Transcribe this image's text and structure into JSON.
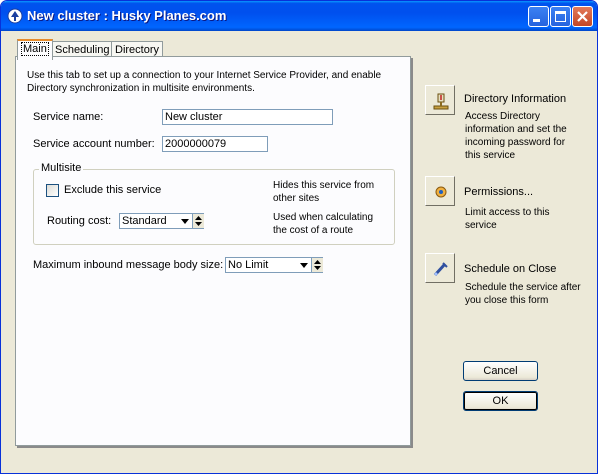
{
  "window": {
    "title": "New cluster : Husky Planes.com"
  },
  "tabs": [
    {
      "label": "Main",
      "active": true
    },
    {
      "label": "Scheduling",
      "active": false
    },
    {
      "label": "Directory",
      "active": false
    }
  ],
  "main": {
    "intro": "Use this tab to set up a connection to your Internet Service Provider, and enable Directory synchronization in multisite environments.",
    "service_name_label": "Service name:",
    "service_name_value": "New cluster",
    "account_label": "Service account number:",
    "account_value": "2000000079",
    "multisite": {
      "title": "Multisite",
      "exclude_label": "Exclude this service",
      "exclude_checked": false,
      "exclude_note": "Hides this service from other sites",
      "routing_label": "Routing cost:",
      "routing_value": "Standard",
      "routing_note": "Used when calculating the cost of a route"
    },
    "max_body_label": "Maximum inbound message body size:",
    "max_body_value": "No Limit"
  },
  "side": {
    "directory": {
      "title": "Directory Information",
      "desc": "Access Directory information and set the incoming password for this service",
      "icon": "directory-icon"
    },
    "permissions": {
      "title": "Permissions...",
      "desc": "Limit access to this service",
      "icon": "permissions-icon"
    },
    "schedule": {
      "title": "Schedule on Close",
      "desc": "Schedule the  service after you close this form",
      "icon": "schedule-icon"
    }
  },
  "buttons": {
    "cancel": "Cancel",
    "ok": "OK"
  },
  "colors": {
    "titlebar": "#0053ee",
    "active_tab_accent": "#e68b2c",
    "face": "#ece9d8"
  }
}
